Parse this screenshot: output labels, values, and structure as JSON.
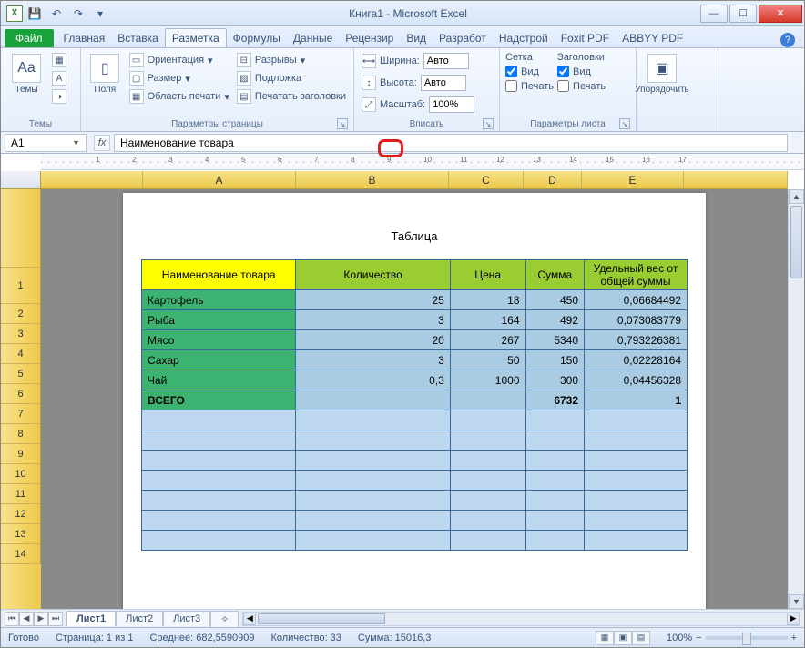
{
  "title": "Книга1  -  Microsoft Excel",
  "qat": {
    "save": "💾",
    "undo": "↶",
    "redo": "↷"
  },
  "tabs": {
    "file": "Файл",
    "home": "Главная",
    "insert": "Вставка",
    "layout": "Разметка",
    "formulas": "Формулы",
    "data": "Данные",
    "review": "Рецензир",
    "view": "Вид",
    "developer": "Разработ",
    "addins": "Надстрой",
    "foxit": "Foxit PDF",
    "abbyy": "ABBYY PDF"
  },
  "ribbon": {
    "themes": {
      "label": "Темы",
      "themes_btn": "Темы"
    },
    "margins": {
      "label": "Поля",
      "btn": "Поля"
    },
    "page_setup": {
      "label": "Параметры страницы",
      "orientation": "Ориентация",
      "size": "Размер",
      "print_area": "Область печати",
      "breaks": "Разрывы",
      "background": "Подложка",
      "print_titles": "Печатать заголовки"
    },
    "scale": {
      "label": "Вписать",
      "width": "Ширина:",
      "width_val": "Авто",
      "height": "Высота:",
      "height_val": "Авто",
      "scale": "Масштаб:",
      "scale_val": "100%"
    },
    "sheet_opts": {
      "label": "Параметры листа",
      "grid": "Сетка",
      "headings": "Заголовки",
      "view": "Вид",
      "print": "Печать"
    },
    "arrange": {
      "label": "",
      "btn": "Упорядочить"
    }
  },
  "namebox": "A1",
  "formula": "Наименование товара",
  "table_title": "Таблица",
  "columns": [
    "A",
    "B",
    "C",
    "D",
    "E"
  ],
  "rows": [
    "1",
    "2",
    "3",
    "4",
    "5",
    "6",
    "7",
    "8",
    "9",
    "10",
    "11",
    "12",
    "13",
    "14"
  ],
  "headers": [
    "Наименование товара",
    "Количество",
    "Цена",
    "Сумма",
    "Удельный вес от общей суммы"
  ],
  "data": [
    {
      "name": "Картофель",
      "qty": "25",
      "price": "18",
      "sum": "450",
      "share": "0,06684492"
    },
    {
      "name": "Рыба",
      "qty": "3",
      "price": "164",
      "sum": "492",
      "share": "0,073083779"
    },
    {
      "name": "Мясо",
      "qty": "20",
      "price": "267",
      "sum": "5340",
      "share": "0,793226381"
    },
    {
      "name": "Сахар",
      "qty": "3",
      "price": "50",
      "sum": "150",
      "share": "0,02228164"
    },
    {
      "name": "Чай",
      "qty": "0,3",
      "price": "1000",
      "sum": "300",
      "share": "0,04456328"
    }
  ],
  "total": {
    "name": "ВСЕГО",
    "sum": "6732",
    "share": "1"
  },
  "sheet_tabs": [
    "Лист1",
    "Лист2",
    "Лист3"
  ],
  "status": {
    "ready": "Готово",
    "page": "Страница: 1 из 1",
    "avg": "Среднее: 682,5590909",
    "count": "Количество: 33",
    "sum": "Сумма: 15016,3",
    "zoom": "100%"
  },
  "chart_data": {
    "type": "table",
    "title": "Таблица",
    "columns": [
      "Наименование товара",
      "Количество",
      "Цена",
      "Сумма",
      "Удельный вес от общей суммы"
    ],
    "rows": [
      [
        "Картофель",
        25,
        18,
        450,
        0.06684492
      ],
      [
        "Рыба",
        3,
        164,
        492,
        0.073083779
      ],
      [
        "Мясо",
        20,
        267,
        5340,
        0.793226381
      ],
      [
        "Сахар",
        3,
        50,
        150,
        0.02228164
      ],
      [
        "Чай",
        0.3,
        1000,
        300,
        0.04456328
      ],
      [
        "ВСЕГО",
        null,
        null,
        6732,
        1
      ]
    ]
  }
}
